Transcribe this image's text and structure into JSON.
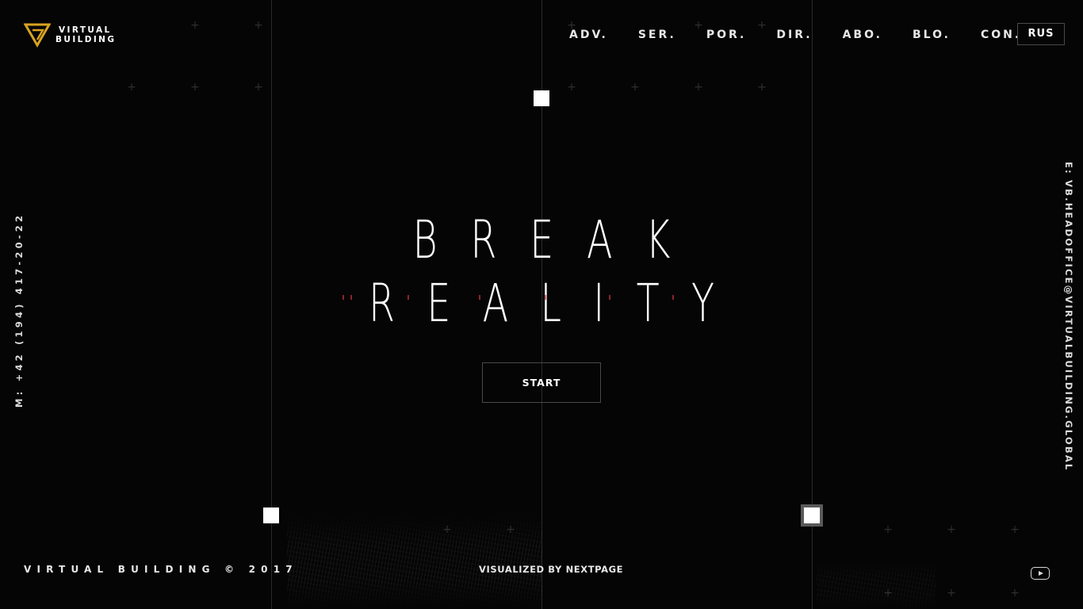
{
  "brand": {
    "line1": "VIRTUAL",
    "line2": "BUILDING",
    "accent": "#d9a320",
    "icon": "virtual-building-logo-icon"
  },
  "nav": {
    "items": [
      {
        "label": "ADV."
      },
      {
        "label": "SER."
      },
      {
        "label": "POR."
      },
      {
        "label": "DIR."
      },
      {
        "label": "ABO."
      },
      {
        "label": "BLO."
      },
      {
        "label": "CON."
      }
    ]
  },
  "lang": {
    "label": "RUS"
  },
  "contacts": {
    "phone": "M: +42 (194) 417-20-22",
    "email": "E: VB.HEADOFFICE@VIRTUALBUILDING.GLOBAL"
  },
  "hero": {
    "line1": "BREAK",
    "line2": "REALITY",
    "cta": "START"
  },
  "footer": {
    "copyright": "VIRTUAL BUILDING © 2017",
    "credits": "VISUALIZED BY NEXTPAGE",
    "social_icon": "youtube-icon"
  },
  "colors": {
    "background": "#050506",
    "text": "#ffffff",
    "grid_line": "#2a2a2c",
    "glitch": "#c8323c"
  }
}
